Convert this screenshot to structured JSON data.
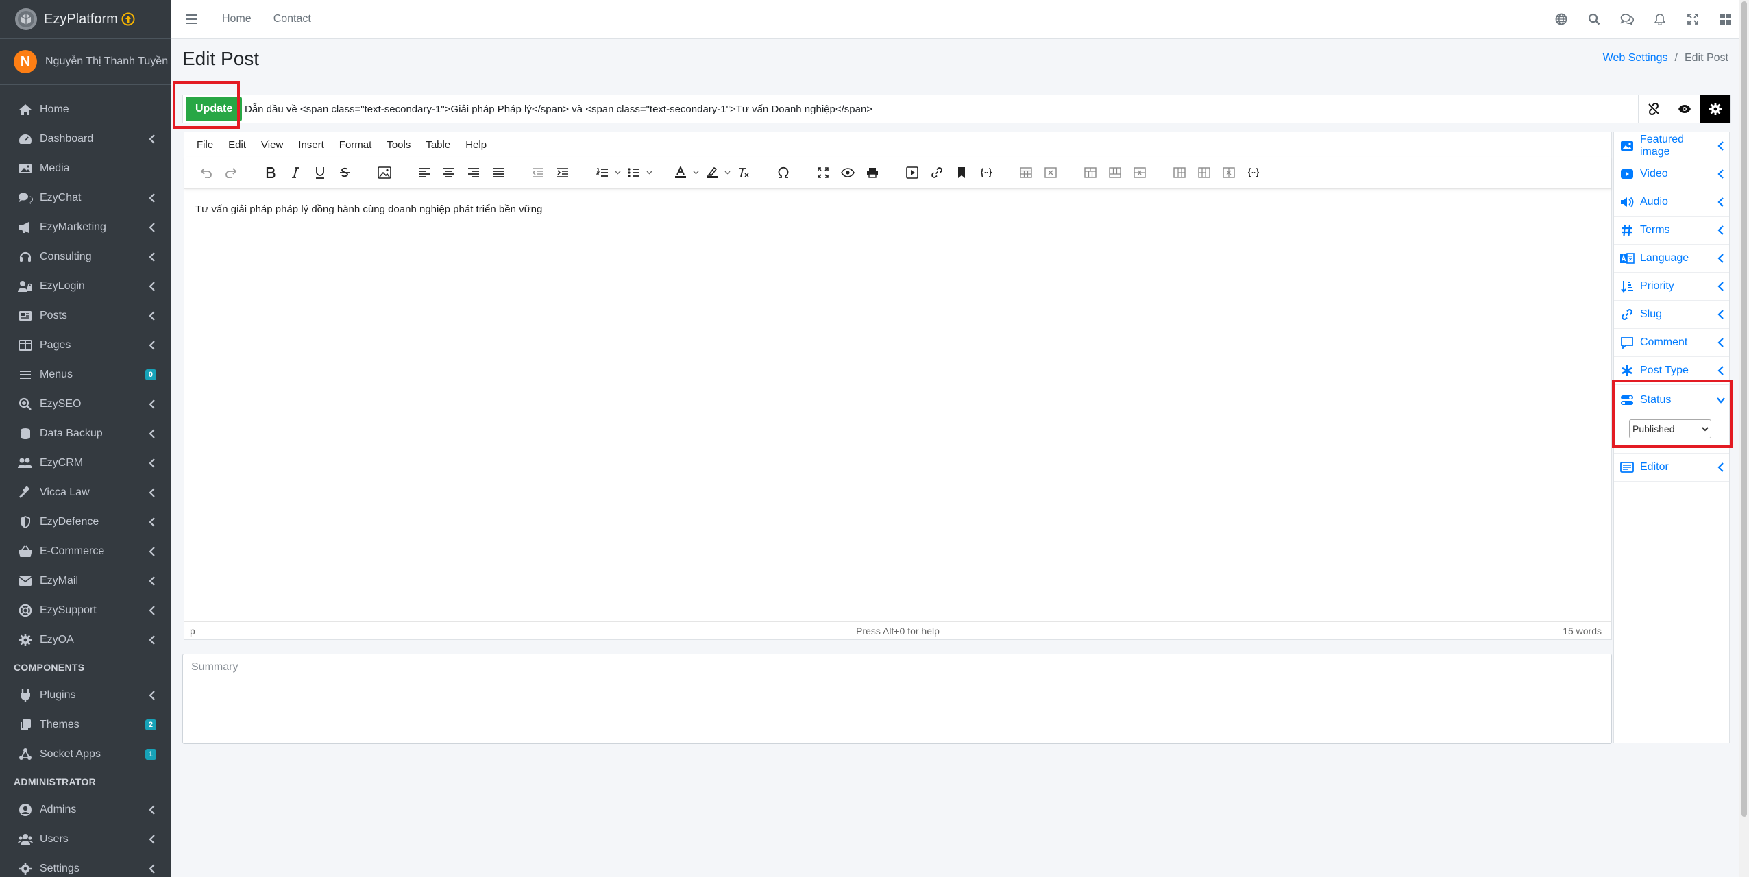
{
  "brand": {
    "name": "EzyPlatform"
  },
  "user": {
    "initial": "N",
    "name": "Nguyễn Thị Thanh Tuyền"
  },
  "sidebar": {
    "items": [
      {
        "label": "Home"
      },
      {
        "label": "Dashboard"
      },
      {
        "label": "Media"
      },
      {
        "label": "EzyChat"
      },
      {
        "label": "EzyMarketing"
      },
      {
        "label": "Consulting"
      },
      {
        "label": "EzyLogin"
      },
      {
        "label": "Posts"
      },
      {
        "label": "Pages"
      },
      {
        "label": "Menus",
        "badge": "0"
      },
      {
        "label": "EzySEO"
      },
      {
        "label": "Data Backup"
      },
      {
        "label": "EzyCRM"
      },
      {
        "label": "Vicca Law"
      },
      {
        "label": "EzyDefence"
      },
      {
        "label": "E-Commerce"
      },
      {
        "label": "EzyMail"
      },
      {
        "label": "EzySupport"
      },
      {
        "label": "EzyOA"
      }
    ],
    "components_header": "COMPONENTS",
    "components": [
      {
        "label": "Plugins"
      },
      {
        "label": "Themes",
        "badge": "2"
      },
      {
        "label": "Socket Apps",
        "badge": "1"
      }
    ],
    "admin_header": "ADMINISTRATOR",
    "admin": [
      {
        "label": "Admins"
      },
      {
        "label": "Users"
      },
      {
        "label": "Settings"
      }
    ]
  },
  "topbar": {
    "links": [
      "Home",
      "Contact"
    ]
  },
  "page": {
    "title": "Edit Post"
  },
  "breadcrumb": {
    "parent": "Web Settings",
    "separator": "/",
    "current": "Edit Post"
  },
  "post": {
    "update_label": "Update",
    "title_value": "Dẫn đầu về <span class=\"text-secondary-1\">Giải pháp Pháp lý</span> và <span class=\"text-secondary-1\">Tư vấn Doanh nghiệp</span>"
  },
  "editor": {
    "menu": [
      "File",
      "Edit",
      "View",
      "Insert",
      "Format",
      "Tools",
      "Table",
      "Help"
    ],
    "content": "Tư vấn giải pháp pháp lý đồng hành cùng doanh nghiệp phát triển bền vững",
    "status_path": "p",
    "status_help": "Press Alt+0 for help",
    "word_count": "15 words"
  },
  "summary": {
    "placeholder": "Summary"
  },
  "right_panel": {
    "items_top": [
      {
        "label": "Featured image"
      },
      {
        "label": "Video"
      },
      {
        "label": "Audio"
      },
      {
        "label": "Terms"
      },
      {
        "label": "Language"
      },
      {
        "label": "Priority"
      },
      {
        "label": "Slug"
      },
      {
        "label": "Comment"
      },
      {
        "label": "Post Type"
      }
    ],
    "status": {
      "label": "Status",
      "selected": "Published"
    },
    "items_bottom": [
      {
        "label": "Editor"
      }
    ]
  },
  "colors": {
    "sidebar_bg": "#343a40",
    "accent": "#007bff",
    "update_green": "#28a745",
    "highlight_red": "#e31b23"
  }
}
